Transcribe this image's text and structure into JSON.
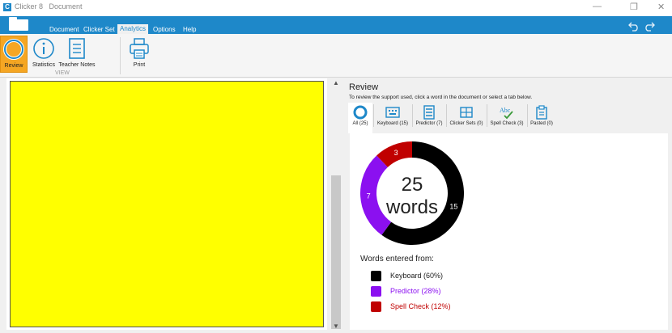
{
  "window": {
    "app_name": "Clicker 8",
    "doc_name": "Document",
    "minimize_glyph": "—",
    "restore_glyph": "❐",
    "close_glyph": "✕"
  },
  "tabs": [
    {
      "label": "Document"
    },
    {
      "label": "Clicker Set"
    },
    {
      "label": "Analytics"
    },
    {
      "label": "Options"
    },
    {
      "label": "Help"
    }
  ],
  "ribbon": {
    "review": "Review",
    "statistics": "Statistics",
    "teacher_notes": "Teacher Notes",
    "print": "Print",
    "group_view": "VIEW"
  },
  "review_panel": {
    "title": "Review",
    "description": "To review the support used, click a word in the document or select a tab below.",
    "tabs": [
      {
        "label": "All (25)",
        "icon": "donut-icon"
      },
      {
        "label": "Keyboard (15)",
        "icon": "keyboard-icon"
      },
      {
        "label": "Predictor (7)",
        "icon": "predictor-icon"
      },
      {
        "label": "Clicker Sets (0)",
        "icon": "clicker-sets-icon"
      },
      {
        "label": "Spell Check (3)",
        "icon": "spell-check-icon"
      },
      {
        "label": "Pasted (0)",
        "icon": "clipboard-icon"
      }
    ],
    "total_number": "25",
    "total_unit": "words",
    "entered_from": "Words entered from:",
    "legend": [
      {
        "label": "Keyboard (60%)",
        "color": "#000000",
        "text_color": "#222222"
      },
      {
        "label": "Predictor (28%)",
        "color": "#8b10f0",
        "text_color": "#8b10f0"
      },
      {
        "label": "Spell Check (12%)",
        "color": "#c00000",
        "text_color": "#c00000"
      }
    ]
  },
  "chart_data": {
    "type": "pie",
    "categories": [
      "Keyboard",
      "Predictor",
      "Spell Check"
    ],
    "values": [
      15,
      7,
      3
    ],
    "colors": [
      "#000000",
      "#8b10f0",
      "#c00000"
    ]
  },
  "colors": {
    "accent": "#1e88c9",
    "active_button": "#f5a623",
    "document_page": "#ffff00"
  }
}
